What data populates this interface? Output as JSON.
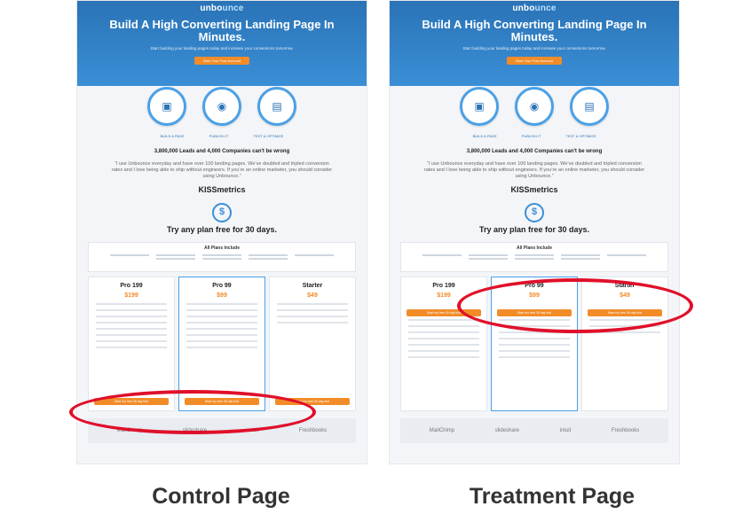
{
  "control": {
    "logo": {
      "primary": "unbo",
      "accent": "unce"
    },
    "headline": "Build A High Converting Landing Page In Minutes.",
    "subhead": "Start building your landing pages today and increase your conversions tomorrow.",
    "cta": "Start Your Free Account",
    "steps": [
      "BUILD A PAGE",
      "PUBLISH IT",
      "TEST & OPTIMIZE"
    ],
    "proof": "3,800,000 Leads and 4,000 Companies can't be wrong",
    "quote": "“I use Unbounce everyday and have over 100 landing pages. We’ve doubled and tripled conversion rates and I love being able to ship without engineers. If you’re an online marketer, you should consider using Unbounce.”",
    "brand": "KISSmetrics",
    "trial": "Try any plan free for 30 days.",
    "plans_title": "All Plans Include",
    "plans": [
      {
        "name": "Pro 199",
        "price": "$199",
        "button": "Start my free 30 day trial"
      },
      {
        "name": "Pro 99",
        "price": "$99",
        "button": "Start my free 30 day trial"
      },
      {
        "name": "Starter",
        "price": "$49",
        "button": "Start my free 30 day trial"
      }
    ],
    "partners": [
      "MailChimp",
      "slideshare",
      "intuit",
      "Freshbooks"
    ]
  },
  "treatment": {
    "logo": {
      "primary": "unbo",
      "accent": "unce"
    },
    "headline": "Build A High Converting Landing Page In Minutes.",
    "subhead": "Start building your landing pages today and increase your conversions tomorrow.",
    "cta": "Start Your Free Account",
    "steps": [
      "BUILD A PAGE",
      "PUBLISH IT",
      "TEST & OPTIMIZE"
    ],
    "proof": "3,800,000 Leads and 4,000 Companies can't be wrong",
    "quote": "“I use Unbounce everyday and have over 100 landing pages. We’ve doubled and tripled conversion rates and I love being able to ship without engineers. If you’re an online marketer, you should consider using Unbounce.”",
    "brand": "KISSmetrics",
    "trial": "Try any plan free for 30 days.",
    "plans_title": "All Plans Include",
    "plans": [
      {
        "name": "Pro 199",
        "price": "$199",
        "button": "Start my free 30 day trial"
      },
      {
        "name": "Pro 99",
        "price": "$99",
        "button": "Start my free 30 day trial"
      },
      {
        "name": "Starter",
        "price": "$49",
        "button": "Start my free 30 day trial"
      }
    ],
    "partners": [
      "MailChimp",
      "slideshare",
      "intuit",
      "Freshbooks"
    ]
  },
  "captions": {
    "left": "Control Page",
    "right": "Treatment Page"
  },
  "colors": {
    "highlight": "#e0102a",
    "accent": "#f28c28",
    "brand": "#2a73b6"
  }
}
